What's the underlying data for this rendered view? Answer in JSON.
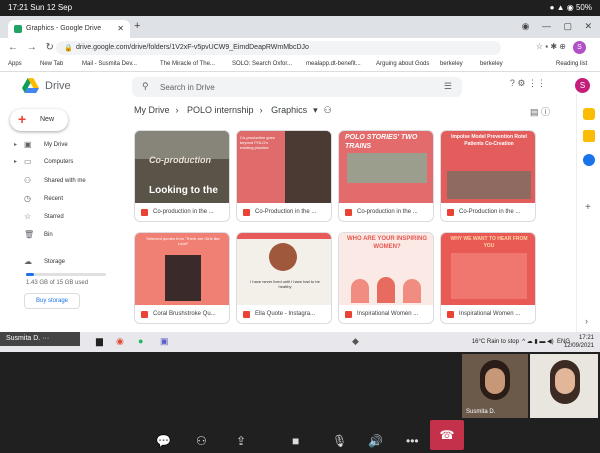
{
  "status": {
    "time_date": "17:21  Sun 12 Sep",
    "battery": "50%"
  },
  "browser": {
    "tab_title": "Graphics - Google Drive",
    "url": "drive.google.com/drive/folders/1V2xF-v5pvUCW9_EimdDeapRWmMbcDJo",
    "bookmarks": [
      "Apps",
      "New Tab",
      "Mail - Susmita Dev...",
      "The Miracle of The...",
      "SOLO: Search Oxfor...",
      "mealapp.dt-benefit...",
      "Arguing about Gods",
      "berkeley",
      "berkeley"
    ],
    "reading_list": "Reading list"
  },
  "drive": {
    "app_name": "Drive",
    "search_placeholder": "Search in Drive",
    "new_label": "New",
    "nav": [
      {
        "label": "My Drive",
        "icon": "my-drive-icon"
      },
      {
        "label": "Computers",
        "icon": "computer-icon"
      },
      {
        "label": "Shared with me",
        "icon": "shared-icon"
      },
      {
        "label": "Recent",
        "icon": "clock-icon"
      },
      {
        "label": "Starred",
        "icon": "star-icon"
      },
      {
        "label": "Bin",
        "icon": "bin-icon"
      }
    ],
    "storage_label": "Storage",
    "storage_used": "1.43 GB of 15 GB used",
    "storage_fraction": 0.095,
    "buy_storage": "Buy storage",
    "breadcrumb": [
      "My Drive",
      "POLO internship",
      "Graphics"
    ],
    "files": [
      {
        "name": "Co-production in the ...",
        "thumb": "Looking to the",
        "thumb_top": "Co-production"
      },
      {
        "name": "Co-Production in the ...",
        "thumb": "Co-production goes beyond POLO's existing practice"
      },
      {
        "name": "Co-production in the ...",
        "thumb": "POLO STORIES' TWO TRAINS"
      },
      {
        "name": "Co-Production in the ...",
        "thumb": "Impolse Model Prevention Rotel Patients Co-Creation"
      },
      {
        "name": "Coral Brushstroke Qu...",
        "thumb": "Selected quotes from 'There are Girls like Lovel'"
      },
      {
        "name": "Ella Quote - Instagra...",
        "thumb": "I have never lived until I have had to be healthy"
      },
      {
        "name": "Inspirational Women ...",
        "thumb": "WHO ARE YOUR INSPIRING WOMEN?"
      },
      {
        "name": "Inspirational Women ...",
        "thumb": "WHY WE WANT TO HEAR FROM YOU"
      }
    ]
  },
  "taskbar": {
    "weather": "16°C  Rain to stop",
    "lang": "ENG",
    "time": "17:21",
    "date": "12/09/2021"
  },
  "teams": {
    "presenter": "Susmita D.",
    "participant_name": "Susmita D."
  }
}
